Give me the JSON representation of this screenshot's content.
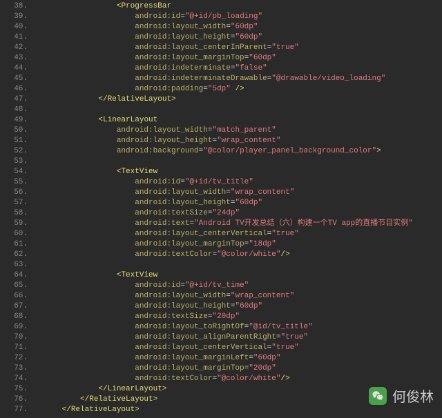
{
  "watermark_text": "何俊林",
  "lines": [
    {
      "n": "38.",
      "indent": 12,
      "parts": [
        {
          "t": "br",
          "v": "<"
        },
        {
          "t": "tag",
          "v": "ProgressBar"
        }
      ]
    },
    {
      "n": "39.",
      "indent": 16,
      "parts": [
        {
          "t": "attr",
          "v": "android:id"
        },
        {
          "t": "eq",
          "v": "="
        },
        {
          "t": "val",
          "v": "\"@+id/pb_loading\""
        }
      ]
    },
    {
      "n": "40.",
      "indent": 16,
      "parts": [
        {
          "t": "attr",
          "v": "android:layout_width"
        },
        {
          "t": "eq",
          "v": "="
        },
        {
          "t": "val",
          "v": "\"60dp\""
        }
      ]
    },
    {
      "n": "41.",
      "indent": 16,
      "parts": [
        {
          "t": "attr",
          "v": "android:layout_height"
        },
        {
          "t": "eq",
          "v": "="
        },
        {
          "t": "val",
          "v": "\"60dp\""
        }
      ]
    },
    {
      "n": "42.",
      "indent": 16,
      "parts": [
        {
          "t": "attr",
          "v": "android:layout_centerInParent"
        },
        {
          "t": "eq",
          "v": "="
        },
        {
          "t": "val",
          "v": "\"true\""
        }
      ]
    },
    {
      "n": "43.",
      "indent": 16,
      "parts": [
        {
          "t": "attr",
          "v": "android:layout_marginTop"
        },
        {
          "t": "eq",
          "v": "="
        },
        {
          "t": "val",
          "v": "\"60dp\""
        }
      ]
    },
    {
      "n": "44.",
      "indent": 16,
      "parts": [
        {
          "t": "attr",
          "v": "android:indeterminate"
        },
        {
          "t": "eq",
          "v": "="
        },
        {
          "t": "val",
          "v": "\"false\""
        }
      ]
    },
    {
      "n": "45.",
      "indent": 16,
      "parts": [
        {
          "t": "attr",
          "v": "android:indeterminateDrawable"
        },
        {
          "t": "eq",
          "v": "="
        },
        {
          "t": "val",
          "v": "\"@drawable/video_loading\""
        }
      ]
    },
    {
      "n": "46.",
      "indent": 16,
      "parts": [
        {
          "t": "attr",
          "v": "android:padding"
        },
        {
          "t": "eq",
          "v": "="
        },
        {
          "t": "val",
          "v": "\"5dp\""
        },
        {
          "t": "br",
          "v": " />"
        }
      ]
    },
    {
      "n": "47.",
      "indent": 8,
      "parts": [
        {
          "t": "br",
          "v": "</"
        },
        {
          "t": "tag",
          "v": "RelativeLayout"
        },
        {
          "t": "br",
          "v": ">"
        }
      ]
    },
    {
      "n": "48.",
      "indent": 0,
      "parts": []
    },
    {
      "n": "49.",
      "indent": 8,
      "parts": [
        {
          "t": "br",
          "v": "<"
        },
        {
          "t": "tag",
          "v": "LinearLayout"
        }
      ]
    },
    {
      "n": "50.",
      "indent": 12,
      "parts": [
        {
          "t": "attr",
          "v": "android:layout_width"
        },
        {
          "t": "eq",
          "v": "="
        },
        {
          "t": "val",
          "v": "\"match_parent\""
        }
      ]
    },
    {
      "n": "51.",
      "indent": 12,
      "parts": [
        {
          "t": "attr",
          "v": "android:layout_height"
        },
        {
          "t": "eq",
          "v": "="
        },
        {
          "t": "val",
          "v": "\"wrap_content\""
        }
      ]
    },
    {
      "n": "52.",
      "indent": 12,
      "parts": [
        {
          "t": "attr",
          "v": "android:background"
        },
        {
          "t": "eq",
          "v": "="
        },
        {
          "t": "val",
          "v": "\"@color/player_panel_background_color\""
        },
        {
          "t": "br",
          "v": ">"
        }
      ]
    },
    {
      "n": "53.",
      "indent": 0,
      "parts": []
    },
    {
      "n": "54.",
      "indent": 12,
      "parts": [
        {
          "t": "br",
          "v": "<"
        },
        {
          "t": "tag",
          "v": "TextView"
        }
      ]
    },
    {
      "n": "55.",
      "indent": 16,
      "parts": [
        {
          "t": "attr",
          "v": "android:id"
        },
        {
          "t": "eq",
          "v": "="
        },
        {
          "t": "val",
          "v": "\"@+id/tv_title\""
        }
      ]
    },
    {
      "n": "56.",
      "indent": 16,
      "parts": [
        {
          "t": "attr",
          "v": "android:layout_width"
        },
        {
          "t": "eq",
          "v": "="
        },
        {
          "t": "val",
          "v": "\"wrap_content\""
        }
      ]
    },
    {
      "n": "57.",
      "indent": 16,
      "parts": [
        {
          "t": "attr",
          "v": "android:layout_height"
        },
        {
          "t": "eq",
          "v": "="
        },
        {
          "t": "val",
          "v": "\"60dp\""
        }
      ]
    },
    {
      "n": "58.",
      "indent": 16,
      "parts": [
        {
          "t": "attr",
          "v": "android:textSize"
        },
        {
          "t": "eq",
          "v": "="
        },
        {
          "t": "val",
          "v": "\"24dp\""
        }
      ]
    },
    {
      "n": "59.",
      "indent": 16,
      "parts": [
        {
          "t": "attr",
          "v": "android:text"
        },
        {
          "t": "eq",
          "v": "="
        },
        {
          "t": "val",
          "v": "\"Android TV开发总结（六）构建一个TV app的直播节目实例\""
        }
      ]
    },
    {
      "n": "60.",
      "indent": 16,
      "parts": [
        {
          "t": "attr",
          "v": "android:layout_centerVertical"
        },
        {
          "t": "eq",
          "v": "="
        },
        {
          "t": "val",
          "v": "\"true\""
        }
      ]
    },
    {
      "n": "61.",
      "indent": 16,
      "parts": [
        {
          "t": "attr",
          "v": "android:layout_marginTop"
        },
        {
          "t": "eq",
          "v": "="
        },
        {
          "t": "val",
          "v": "\"18dp\""
        }
      ]
    },
    {
      "n": "62.",
      "indent": 16,
      "parts": [
        {
          "t": "attr",
          "v": "android:textColor"
        },
        {
          "t": "eq",
          "v": "="
        },
        {
          "t": "val",
          "v": "\"@color/white\""
        },
        {
          "t": "br",
          "v": "/>"
        }
      ]
    },
    {
      "n": "63.",
      "indent": 0,
      "parts": []
    },
    {
      "n": "64.",
      "indent": 12,
      "parts": [
        {
          "t": "br",
          "v": "<"
        },
        {
          "t": "tag",
          "v": "TextView"
        }
      ]
    },
    {
      "n": "65.",
      "indent": 16,
      "parts": [
        {
          "t": "attr",
          "v": "android:id"
        },
        {
          "t": "eq",
          "v": "="
        },
        {
          "t": "val",
          "v": "\"@+id/tv_time\""
        }
      ]
    },
    {
      "n": "66.",
      "indent": 16,
      "parts": [
        {
          "t": "attr",
          "v": "android:layout_width"
        },
        {
          "t": "eq",
          "v": "="
        },
        {
          "t": "val",
          "v": "\"wrap_content\""
        }
      ]
    },
    {
      "n": "67.",
      "indent": 16,
      "parts": [
        {
          "t": "attr",
          "v": "android:layout_height"
        },
        {
          "t": "eq",
          "v": "="
        },
        {
          "t": "val",
          "v": "\"60dp\""
        }
      ]
    },
    {
      "n": "68.",
      "indent": 16,
      "parts": [
        {
          "t": "attr",
          "v": "android:textSize"
        },
        {
          "t": "eq",
          "v": "="
        },
        {
          "t": "val",
          "v": "\"20dp\""
        }
      ]
    },
    {
      "n": "69.",
      "indent": 16,
      "parts": [
        {
          "t": "attr",
          "v": "android:layout_toRightOf"
        },
        {
          "t": "eq",
          "v": "="
        },
        {
          "t": "val",
          "v": "\"@id/tv_title\""
        }
      ]
    },
    {
      "n": "70.",
      "indent": 16,
      "parts": [
        {
          "t": "attr",
          "v": "android:layout_alignParentRight"
        },
        {
          "t": "eq",
          "v": "="
        },
        {
          "t": "val",
          "v": "\"true\""
        }
      ]
    },
    {
      "n": "71.",
      "indent": 16,
      "parts": [
        {
          "t": "attr",
          "v": "android:layout_centerVertical"
        },
        {
          "t": "eq",
          "v": "="
        },
        {
          "t": "val",
          "v": "\"true\""
        }
      ]
    },
    {
      "n": "72.",
      "indent": 16,
      "parts": [
        {
          "t": "attr",
          "v": "android:layout_marginLeft"
        },
        {
          "t": "eq",
          "v": "="
        },
        {
          "t": "val",
          "v": "\"60dp\""
        }
      ]
    },
    {
      "n": "73.",
      "indent": 16,
      "parts": [
        {
          "t": "attr",
          "v": "android:layout_marginTop"
        },
        {
          "t": "eq",
          "v": "="
        },
        {
          "t": "val",
          "v": "\"20dp\""
        }
      ]
    },
    {
      "n": "74.",
      "indent": 16,
      "parts": [
        {
          "t": "attr",
          "v": "android:textColor"
        },
        {
          "t": "eq",
          "v": "="
        },
        {
          "t": "val",
          "v": "\"@color/white\""
        },
        {
          "t": "br",
          "v": "/>"
        }
      ]
    },
    {
      "n": "75.",
      "indent": 8,
      "parts": [
        {
          "t": "br",
          "v": "</"
        },
        {
          "t": "tag",
          "v": "LinearLayout"
        },
        {
          "t": "br",
          "v": ">"
        }
      ]
    },
    {
      "n": "76.",
      "indent": 4,
      "parts": [
        {
          "t": "br",
          "v": "</"
        },
        {
          "t": "tag",
          "v": "RelativeLayout"
        },
        {
          "t": "br",
          "v": ">"
        }
      ]
    },
    {
      "n": "77.",
      "indent": 0,
      "parts": [
        {
          "t": "br",
          "v": "</"
        },
        {
          "t": "tag",
          "v": "RelativeLayout"
        },
        {
          "t": "br",
          "v": ">"
        }
      ]
    }
  ]
}
